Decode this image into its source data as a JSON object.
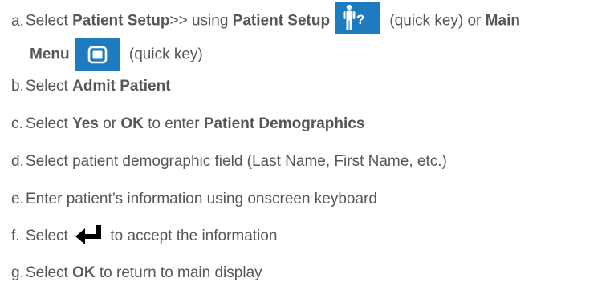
{
  "steps": [
    {
      "letter": "a.",
      "parts": {
        "t1": "Select ",
        "b1": "Patient Setup",
        "t2": ">> using ",
        "b2": "Patient Setup",
        "t3": " (quick key) or ",
        "b3": "Main",
        "b4": "Menu",
        "t4": " (quick key)"
      },
      "icons": [
        "patient-setup-key-icon",
        "main-menu-key-icon"
      ]
    },
    {
      "letter": "b.",
      "parts": {
        "t1": "Select ",
        "b1": "Admit Patient"
      }
    },
    {
      "letter": "c.",
      "parts": {
        "t1": "Select ",
        "b1": "Yes",
        "t2": " or ",
        "b2": "OK",
        "t3": " to enter ",
        "b3": "Patient Demographics"
      }
    },
    {
      "letter": "d.",
      "parts": {
        "t1": "Select patient demographic field (Last Name, First Name, etc.)"
      }
    },
    {
      "letter": "e.",
      "parts": {
        "t1": "Enter patient’s information using onscreen keyboard"
      }
    },
    {
      "letter": "f.",
      "parts": {
        "t1": "Select ",
        "t2": " to accept the information"
      },
      "icons": [
        "enter-arrow-icon"
      ]
    },
    {
      "letter": "g.",
      "parts": {
        "t1": "Select ",
        "b1": "OK",
        "t2": " to return to main display"
      }
    }
  ],
  "colors": {
    "text": "#55565a",
    "key_background": "#1f7bbf",
    "icon_foreground": "#ffffff",
    "enter_arrow": "#000000"
  }
}
